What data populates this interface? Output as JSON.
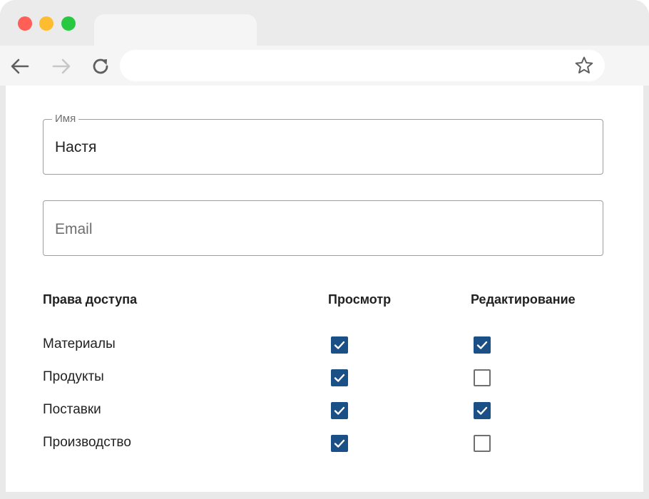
{
  "browser": {
    "icons": {
      "back": "arrow-left-icon",
      "forward": "arrow-right-icon",
      "reload": "reload-icon",
      "bookmark": "star-icon"
    },
    "address": ""
  },
  "form": {
    "name_field": {
      "label": "Имя",
      "value": "Настя"
    },
    "email_field": {
      "placeholder": "Email",
      "value": ""
    }
  },
  "permissions": {
    "headers": {
      "permission": "Права доступа",
      "view": "Просмотр",
      "edit": "Редактирование"
    },
    "rows": [
      {
        "label": "Материалы",
        "view": true,
        "edit": true
      },
      {
        "label": "Продукты",
        "view": true,
        "edit": false
      },
      {
        "label": "Поставки",
        "view": true,
        "edit": true
      },
      {
        "label": "Производство",
        "view": true,
        "edit": false
      }
    ]
  },
  "colors": {
    "checkbox_checked": "#1b5087",
    "checkbox_unchecked_border": "#707070"
  }
}
